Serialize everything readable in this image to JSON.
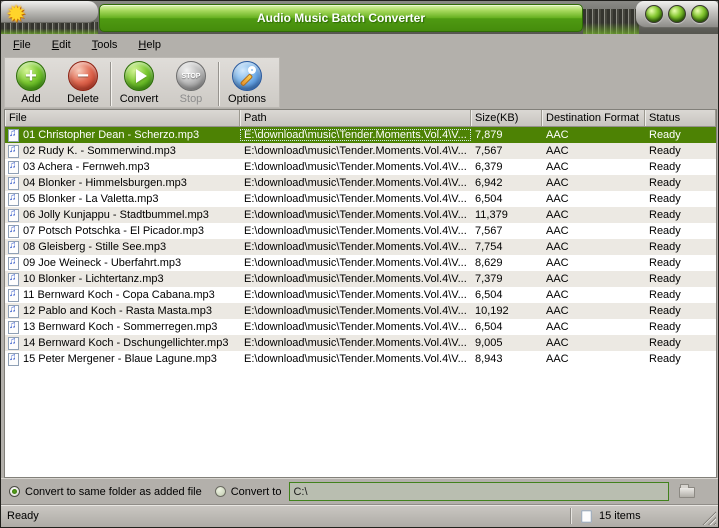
{
  "window": {
    "title": "Audio Music Batch Converter",
    "controls": [
      {
        "name": "minimize"
      },
      {
        "name": "maximize"
      },
      {
        "name": "close"
      }
    ]
  },
  "menu": {
    "items": [
      {
        "label": "File"
      },
      {
        "label": "Edit"
      },
      {
        "label": "Tools"
      },
      {
        "label": "Help"
      }
    ]
  },
  "toolbar": {
    "buttons": [
      {
        "label": "Add",
        "icon": "plus-icon",
        "disabled": false
      },
      {
        "label": "Delete",
        "icon": "minus-icon",
        "disabled": false
      },
      {
        "label": "Convert",
        "icon": "play-icon",
        "disabled": false
      },
      {
        "label": "Stop",
        "icon": "stop-icon",
        "icon_text": "STOP",
        "disabled": true
      },
      {
        "label": "Options",
        "icon": "wrench-icon",
        "disabled": false
      }
    ]
  },
  "table": {
    "columns": [
      "File",
      "Path",
      "Size(KB)",
      "Destination Format",
      "Status"
    ],
    "file_icon_glyph": "♫",
    "selected_index": 0,
    "rows": [
      {
        "file": "01 Christopher Dean - Scherzo.mp3",
        "path": "E:\\download\\music\\Tender.Moments.Vol.4\\V...",
        "size": "7,879",
        "format": "AAC",
        "status": "Ready"
      },
      {
        "file": "02 Rudy K.  - Sommerwind.mp3",
        "path": "E:\\download\\music\\Tender.Moments.Vol.4\\V...",
        "size": "7,567",
        "format": "AAC",
        "status": "Ready"
      },
      {
        "file": "03 Achera - Fernweh.mp3",
        "path": "E:\\download\\music\\Tender.Moments.Vol.4\\V...",
        "size": "6,379",
        "format": "AAC",
        "status": "Ready"
      },
      {
        "file": "04 Blonker - Himmelsburgen.mp3",
        "path": "E:\\download\\music\\Tender.Moments.Vol.4\\V...",
        "size": "6,942",
        "format": "AAC",
        "status": "Ready"
      },
      {
        "file": "05 Blonker - La Valetta.mp3",
        "path": "E:\\download\\music\\Tender.Moments.Vol.4\\V...",
        "size": "6,504",
        "format": "AAC",
        "status": "Ready"
      },
      {
        "file": "06 Jolly Kunjappu - Stadtbummel.mp3",
        "path": "E:\\download\\music\\Tender.Moments.Vol.4\\V...",
        "size": "11,379",
        "format": "AAC",
        "status": "Ready"
      },
      {
        "file": "07 Potsch Potschka - El Picador.mp3",
        "path": "E:\\download\\music\\Tender.Moments.Vol.4\\V...",
        "size": "7,567",
        "format": "AAC",
        "status": "Ready"
      },
      {
        "file": "08 Gleisberg - Stille See.mp3",
        "path": "E:\\download\\music\\Tender.Moments.Vol.4\\V...",
        "size": "7,754",
        "format": "AAC",
        "status": "Ready"
      },
      {
        "file": "09 Joe Weineck - Uberfahrt.mp3",
        "path": "E:\\download\\music\\Tender.Moments.Vol.4\\V...",
        "size": "8,629",
        "format": "AAC",
        "status": "Ready"
      },
      {
        "file": "10 Blonker - Lichtertanz.mp3",
        "path": "E:\\download\\music\\Tender.Moments.Vol.4\\V...",
        "size": "7,379",
        "format": "AAC",
        "status": "Ready"
      },
      {
        "file": "11 Bernward Koch - Copa Cabana.mp3",
        "path": "E:\\download\\music\\Tender.Moments.Vol.4\\V...",
        "size": "6,504",
        "format": "AAC",
        "status": "Ready"
      },
      {
        "file": "12 Pablo and Koch - Rasta Masta.mp3",
        "path": "E:\\download\\music\\Tender.Moments.Vol.4\\V...",
        "size": "10,192",
        "format": "AAC",
        "status": "Ready"
      },
      {
        "file": "13 Bernward Koch - Sommerregen.mp3",
        "path": "E:\\download\\music\\Tender.Moments.Vol.4\\V...",
        "size": "6,504",
        "format": "AAC",
        "status": "Ready"
      },
      {
        "file": "14 Bernward Koch - Dschungellichter.mp3",
        "path": "E:\\download\\music\\Tender.Moments.Vol.4\\V...",
        "size": "9,005",
        "format": "AAC",
        "status": "Ready"
      },
      {
        "file": "15 Peter Mergener - Blaue Lagune.mp3",
        "path": "E:\\download\\music\\Tender.Moments.Vol.4\\V...",
        "size": "8,943",
        "format": "AAC",
        "status": "Ready"
      }
    ]
  },
  "footer": {
    "radio_same_label": "Convert to same folder as added file",
    "radio_same_checked": true,
    "radio_to_label": "Convert to",
    "radio_to_checked": false,
    "path_value": "C:\\",
    "browse_icon": "folder-icon"
  },
  "statusbar": {
    "left": "Ready",
    "items_label": "15 items",
    "items_icon": "music-note-icon"
  },
  "colors": {
    "titlebar_green": "#66b01f",
    "selected_row": "#4d8204",
    "accent_green": "#41821c"
  }
}
